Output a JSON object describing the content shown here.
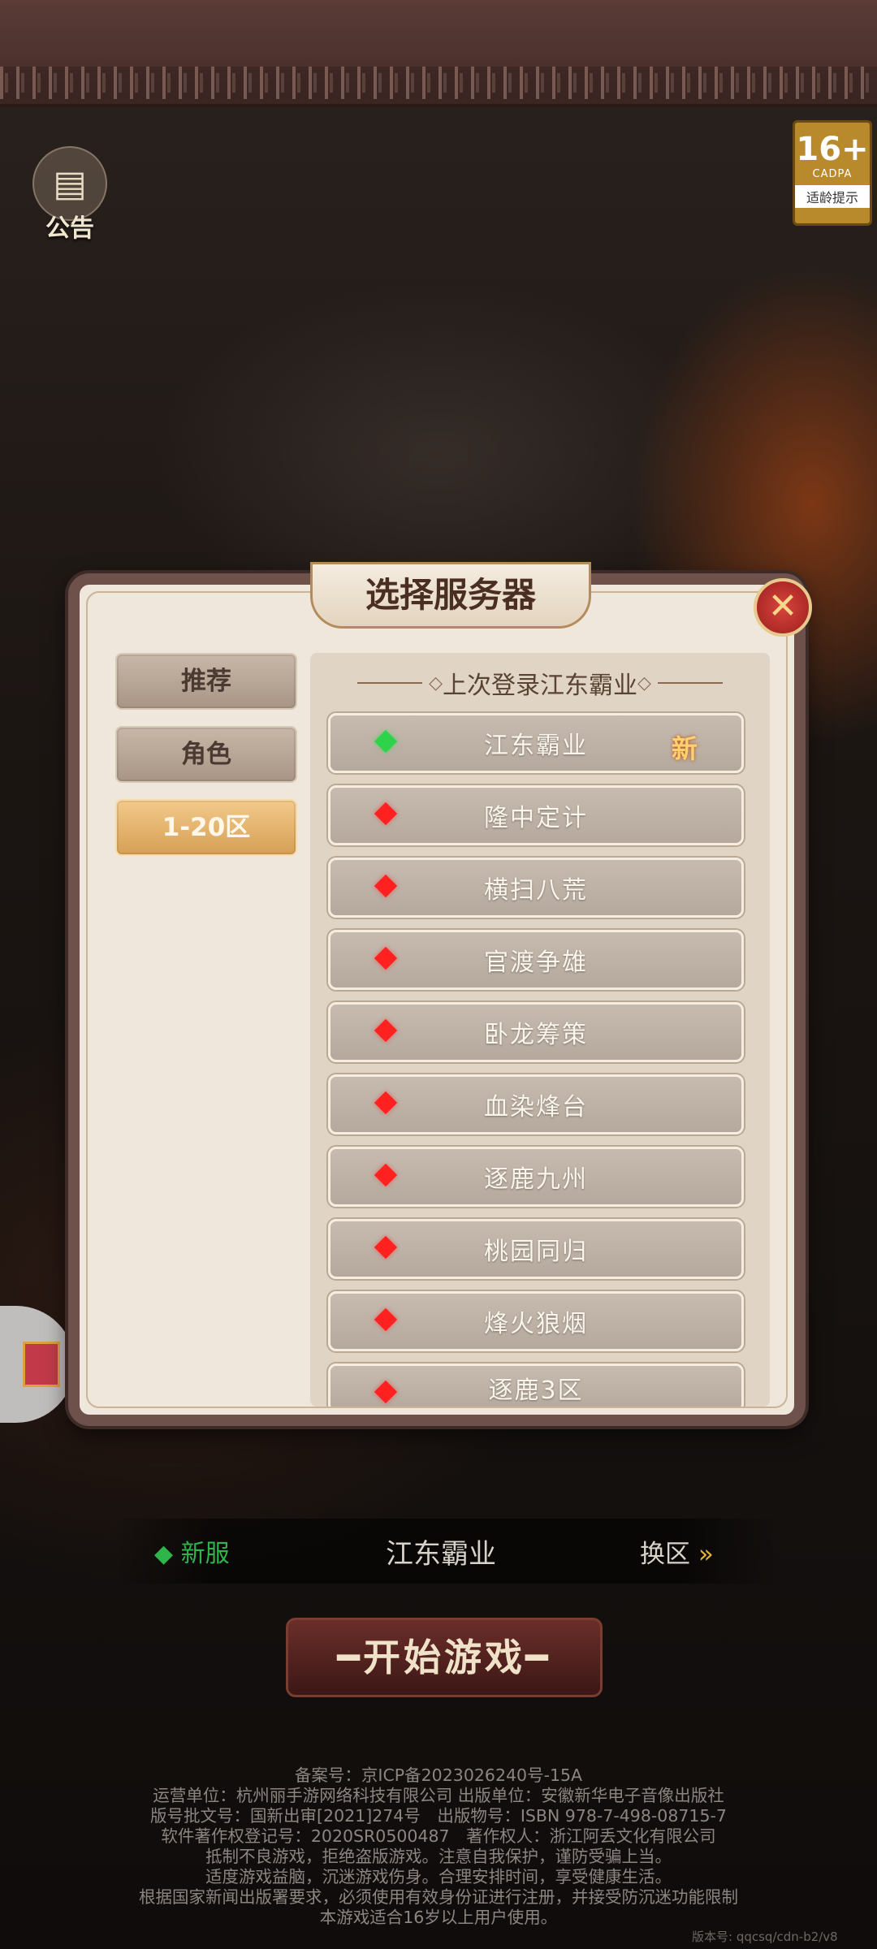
{
  "notice": {
    "label": "公告"
  },
  "age_rating": {
    "value": "16+",
    "org": "CADPA",
    "tip": "适龄提示"
  },
  "modal": {
    "title": "选择服务器",
    "tabs": [
      "推荐",
      "角色",
      "1-20区"
    ],
    "active_tab": "1-20区",
    "last_login": "上次登录江东霸业",
    "servers": [
      {
        "name": "江东霸业",
        "status": "green",
        "badge": "新"
      },
      {
        "name": "隆中定计",
        "status": "red"
      },
      {
        "name": "横扫八荒",
        "status": "red"
      },
      {
        "name": "官渡争雄",
        "status": "red"
      },
      {
        "name": "卧龙筹策",
        "status": "red"
      },
      {
        "name": "血染烽台",
        "status": "red"
      },
      {
        "name": "逐鹿九州",
        "status": "red"
      },
      {
        "name": "桃园同归",
        "status": "red"
      },
      {
        "name": "烽火狼烟",
        "status": "red"
      },
      {
        "name": "逐鹿3区",
        "status": "red"
      }
    ]
  },
  "bottom": {
    "new_tag": "◆ 新服",
    "current_server": "江东霸业",
    "switch_label": "换区",
    "switch_arrow": "»"
  },
  "start_button": "━开始游戏━",
  "legal": [
    "备案号：京ICP备2023026240号-15A",
    "运营单位：杭州丽手游网络科技有限公司 出版单位：安徽新华电子音像出版社",
    "版号批文号：国新出审[2021]274号　出版物号：ISBN 978-7-498-08715-7",
    "软件著作权登记号：2020SR0500487　著作权人：浙江阿丢文化有限公司",
    "抵制不良游戏，拒绝盗版游戏。注意自我保护，谨防受骗上当。",
    "适度游戏益脑，沉迷游戏伤身。合理安排时间，享受健康生活。",
    "根据国家新闻出版署要求，必须使用有效身份证进行注册，并接受防沉迷功能限制",
    "本游戏适合16岁以上用户使用。"
  ],
  "version": "版本号: qqcsq/cdn-b2/v8"
}
